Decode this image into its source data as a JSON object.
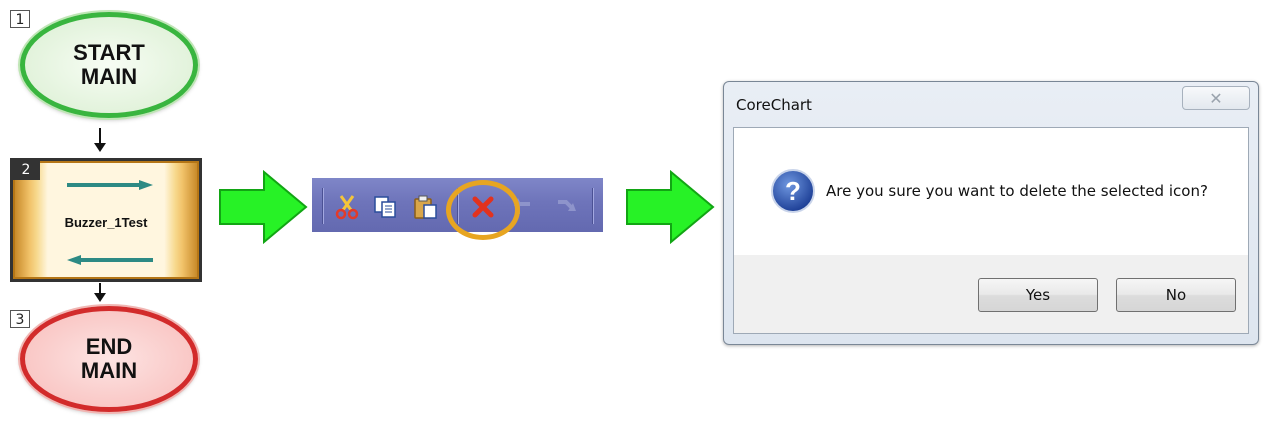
{
  "flowchart": {
    "steps": [
      {
        "number": "1",
        "label": "START\nMAIN"
      },
      {
        "number": "2",
        "label": "Buzzer_1Test"
      },
      {
        "number": "3",
        "label": "END\nMAIN"
      }
    ]
  },
  "toolbar": {
    "buttons": [
      "cut-icon",
      "copy-icon",
      "paste-icon",
      "delete-icon",
      "undo-icon",
      "redo-icon"
    ],
    "highlighted": "delete-icon",
    "highlight_color": "#e7a521"
  },
  "dialog": {
    "title": "CoreChart",
    "close_glyph": "✕",
    "message": "Are you sure you want to delete the selected icon?",
    "icon": "question-icon",
    "yes_label": "Yes",
    "no_label": "No"
  },
  "colors": {
    "arrow_green": "#27f226",
    "start_border": "#39b53f",
    "end_border": "#d22b2b"
  }
}
